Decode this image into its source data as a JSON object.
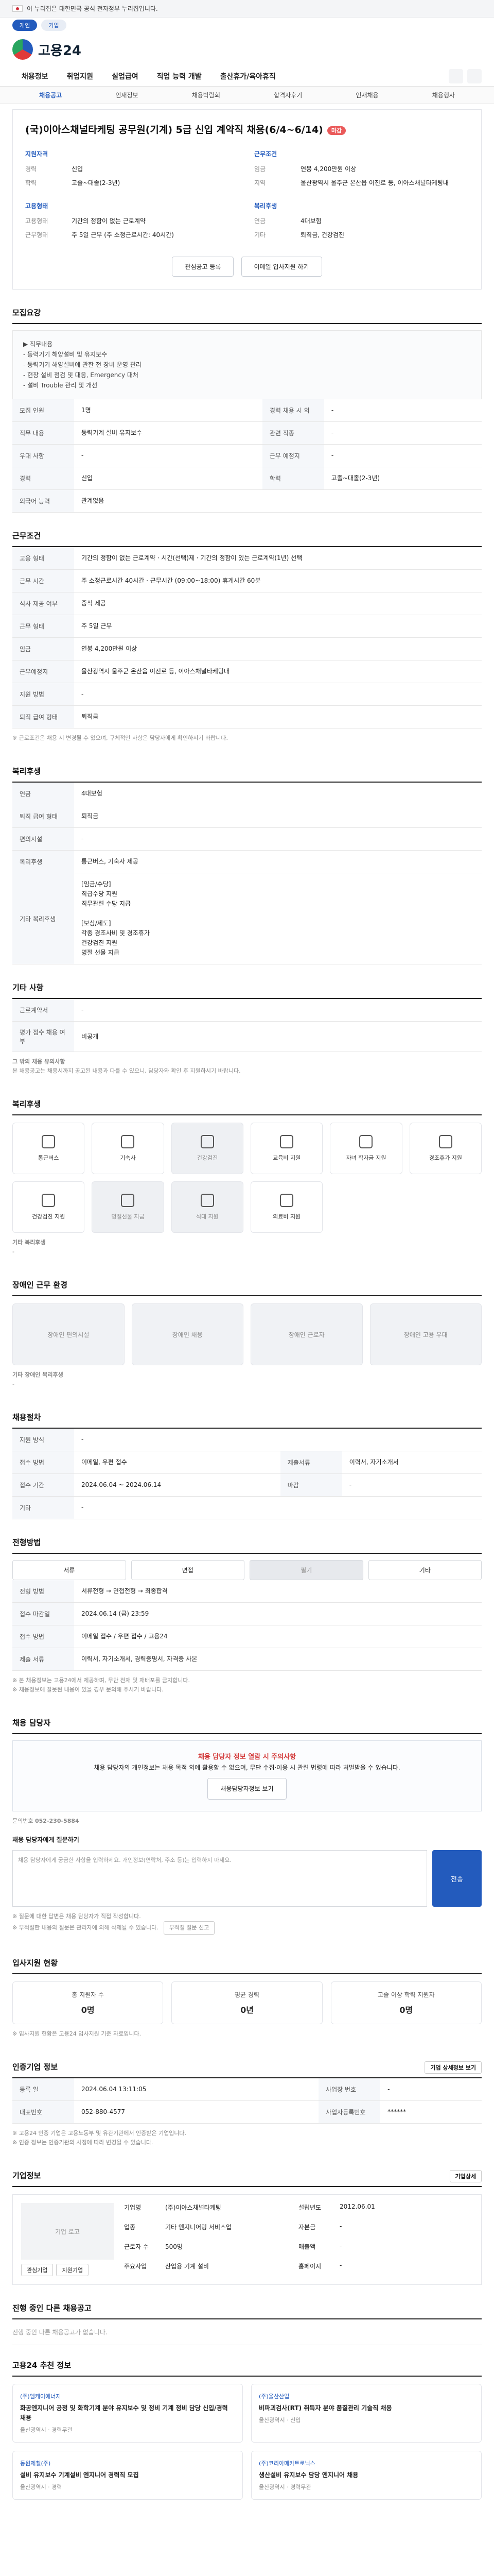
{
  "gov_banner": "이 누리집은 대한민국 공식 전자정부 누리집입니다.",
  "top_tabs": [
    "개인",
    "기업"
  ],
  "logo": "고용24",
  "gnb": [
    "채용정보",
    "취업지원",
    "실업급여",
    "직업 능력 개발",
    "출산휴가/육아휴직"
  ],
  "subnav": [
    "채용공고",
    "인재정보",
    "채용박람회",
    "합격자후기",
    "인재채용",
    "채용행사"
  ],
  "job": {
    "title": "(국)이아스채널타케팅 공무원(기계) 5급 신입 계약직 채용(6/4~6/14)",
    "tag": "마감",
    "left_head": "지원자격",
    "left": [
      [
        "경력",
        "신입"
      ],
      [
        "학력",
        "고졸~대졸(2-3년)"
      ]
    ],
    "right_head": "근무조건",
    "right": [
      [
        "임금",
        "연봉 4,200만원 이상"
      ],
      [
        "지역",
        "울산광역시 울주군 온산읍 이진로 등, 이아스채널타케팅내"
      ]
    ],
    "left2_head": "고용형태",
    "left2": [
      [
        "고용형태",
        "기간의 정함이 없는 근로계약"
      ],
      [
        "근무형태",
        "주 5일 근무 (주 소정근로시간: 40시간)"
      ]
    ],
    "right2_head": "복리후생",
    "right2": [
      [
        "연금",
        "4대보험"
      ],
      [
        "기타",
        "퇴직금, 건강검진"
      ]
    ],
    "btn1": "관심공고 등록",
    "btn2": "이메일 입사지원 하기"
  },
  "sec_recruit": {
    "title": "모집요강",
    "desc": "▶ 직무내용\n - 동력기기 해양설비 및 유지보수\n - 동력기기 해양설비에 관한 전 장비 운영 관리\n - 현장 설비 점검 및 대응, Emergency 대처\n - 설비 Trouble 관리 및 개선",
    "rows": [
      [
        "모집 인원",
        "1명",
        "경력 채용 시 외",
        "-"
      ],
      [
        "직무 내용",
        "동력기계 설비 유지보수",
        "관련 직종",
        "-"
      ],
      [
        "우대 사항",
        "-",
        "근무 예정지",
        "-"
      ],
      [
        "경력",
        "신입",
        "학력",
        "고졸~대졸(2-3년)"
      ],
      [
        "외국어 능력",
        "관계없음",
        "",
        ""
      ]
    ]
  },
  "sec_cond": {
    "title": "근무조건",
    "rows": [
      [
        "고용 형태",
        "기간의 정함이 없는 근로계약 · 시간(선택)제 · 기간의 정함이 있는 근로계약(1년) 선택"
      ],
      [
        "근무 시간",
        "주 소정근로시간 40시간 · 근무시간 (09:00~18:00) 휴게시간 60분"
      ],
      [
        "식사 제공 여부",
        "중식 제공"
      ],
      [
        "근무 형태",
        "주 5일 근무"
      ],
      [
        "임금",
        "연봉 4,200만원 이상"
      ],
      [
        "근무예정지",
        "울산광역시 울주군 온산읍 이진로 등, 이아스채널타케팅내"
      ],
      [
        "지원 방법",
        "-"
      ],
      [
        "퇴직 급여 형태",
        "퇴직금"
      ]
    ],
    "note": "※ 근로조건은 채용 시 변경될 수 있으며, 구체적인 사항은 담당자에게 확인하시기 바랍니다."
  },
  "sec_benefit": {
    "title": "복리후생",
    "rows": [
      [
        "연금",
        "4대보험"
      ],
      [
        "퇴직 급여 형태",
        "퇴직금"
      ],
      [
        "편의시설",
        "-"
      ],
      [
        "복리후생",
        "통근버스, 기숙사 제공"
      ],
      [
        "기타 복리후생",
        "[임금/수당]\n 직급수당 지원\n 직무관련 수당 지급\n\n[보상/제도]\n 각종 경조사비 및 경조휴가\n 건강검진 지원\n 명절 선물 지급"
      ]
    ]
  },
  "sec_apply": {
    "title": "기타 사항",
    "rows": [
      [
        "근로계약서",
        "-"
      ],
      [
        "평가 점수 채용 여부",
        "비공개"
      ]
    ],
    "notice_title": "그 밖의 채용 유의사항",
    "notice": "본 채용공고는 채용시까지 공고된 내용과 다를 수 있으니, 담당자와 확인 후 지원하시기 바랍니다."
  },
  "sec_facility": {
    "title": "복리후생",
    "items": [
      "통근버스",
      "기숙사",
      "건강검진",
      "교육비 지원",
      "자녀 학자금 지원",
      "경조휴가 지원",
      "건강검진 지원",
      "명절선물 지급",
      "식대 지원",
      "의료비 지원",
      "",
      ""
    ],
    "sub_title": "기타 복리후생",
    "sub": "-"
  },
  "sec_env": {
    "title": "장애인 근무 환경",
    "items": [
      "장애인 편의시설",
      "장애인 채용",
      "장애인 근로자",
      "장애인 고용 우대"
    ],
    "sub_title": "기타 장애인 복리후생",
    "sub": "-"
  },
  "sec_support": {
    "title": "채용절차",
    "rows": [
      [
        "지원 방식",
        "-",
        "",
        ""
      ],
      [
        "접수 방법",
        "이메일, 우편 접수",
        "제출서류",
        "이력서, 자기소개서"
      ],
      [
        "접수 기간",
        "2024.06.04 ~ 2024.06.14",
        "마감",
        "-"
      ],
      [
        "기타",
        "-",
        "",
        ""
      ]
    ]
  },
  "sec_selection": {
    "title": "전형방법",
    "steps": [
      "서류",
      "면접",
      "필기",
      "기타"
    ],
    "rows": [
      [
        "전형 방법",
        "서류전형 → 면접전형 → 최종합격"
      ],
      [
        "접수 마감일",
        "2024.06.14 (금) 23:59"
      ],
      [
        "접수 방법",
        "이메일 접수 / 우편 접수 / 고용24"
      ],
      [
        "제출 서류",
        "이력서, 자기소개서, 경력증명서, 자격증 사본"
      ]
    ],
    "notes": [
      "※ 본 채용정보는 고용24에서 제공하며, 무단 전재 및 재배포를 금지합니다.",
      "※ 채용정보에 잘못된 내용이 있을 경우 문의해 주시기 바랍니다."
    ]
  },
  "sec_contact": {
    "title": "채용 담당자",
    "alert": "채용 담당자 정보 열람 시 주의사항",
    "alert_text": "채용 담당자의 개인정보는 채용 목적 외에 활용할 수 없으며, 무단 수집·이용 시 관련 법령에 따라 처벌받을 수 있습니다.",
    "alert_btn": "채용담당자정보 보기",
    "label": "문의번호",
    "phone": "052-230-5884",
    "msg_title": "채용 담당자에게 질문하기",
    "msg_placeholder": "채용 담당자에게 궁금한 사항을 입력하세요. 개인정보(연락처, 주소 등)는 입력하지 마세요.",
    "send": "전송",
    "notes": [
      "※ 질문에 대한 답변은 채용 담당자가 직접 작성합니다.",
      "※ 부적절한 내용의 질문은 관리자에 의해 삭제될 수 있습니다."
    ],
    "bad_btn": "부적절 질문 신고"
  },
  "sec_stats": {
    "title": "입사지원 현황",
    "items": [
      [
        "총 지원자 수",
        "0명"
      ],
      [
        "평균 경력",
        "0년"
      ],
      [
        "고졸 이상 학력 지원자",
        "0명"
      ]
    ],
    "note": "※ 입사지원 현황은 고용24 입사지원 기준 자료입니다."
  },
  "sec_info": {
    "title": "인증기업 정보",
    "btn": "기업 상세정보 보기",
    "rows": [
      [
        "등록 일",
        "2024.06.04 13:11:05",
        "사업장 번호",
        "-"
      ],
      [
        "대표번호",
        "052-880-4577",
        "사업자등록번호",
        "******"
      ]
    ],
    "notes": [
      "※ 고용24 인증 기업은 고용노동부 및 유관기관에서 인증받은 기업입니다.",
      "※ 인증 정보는 인증기관의 사정에 따라 변경될 수 있습니다."
    ]
  },
  "sec_company": {
    "title": "기업정보",
    "btn": "기업상세",
    "logo_text": "기업 로고",
    "btns": [
      "관심기업",
      "지원기업"
    ],
    "rows": [
      [
        "기업명",
        "(주)이아스채널타케팅",
        "설립년도",
        "2012.06.01"
      ],
      [
        "업종",
        "기타 엔지니어링 서비스업",
        "자본금",
        "-"
      ],
      [
        "근로자 수",
        "500명",
        "매출액",
        "-"
      ],
      [
        "주요사업",
        "산업용 기계 설비",
        "홈페이지",
        "-"
      ]
    ]
  },
  "sec_related": {
    "title": "진행 중인 다른 채용공고",
    "empty": "진행 중인 다른 채용공고가 없습니다.",
    "title2": "고용24 추천 정보",
    "items": [
      {
        "co": "(주)엠케이에너지",
        "title": "화공엔지니어 공정 및 화학기계 분야 유지보수 및 정비 기계 정비 담당 신입/경력 채용",
        "meta": "울산광역시 · 경력무관"
      },
      {
        "co": "(주)울산산업",
        "title": "비파괴검사(RT) 취득자 분야 품질관리 기술직 채용",
        "meta": "울산광역시 · 신입"
      },
      {
        "co": "동원제철(주)",
        "title": "설비 유지보수 기계설비 엔지니어 경력직 모집",
        "meta": "울산광역시 · 경력"
      },
      {
        "co": "(주)코리아메카트로닉스",
        "title": "생산설비 유지보수 담당 엔지니어 채용",
        "meta": "울산광역시 · 경력무관"
      }
    ]
  }
}
